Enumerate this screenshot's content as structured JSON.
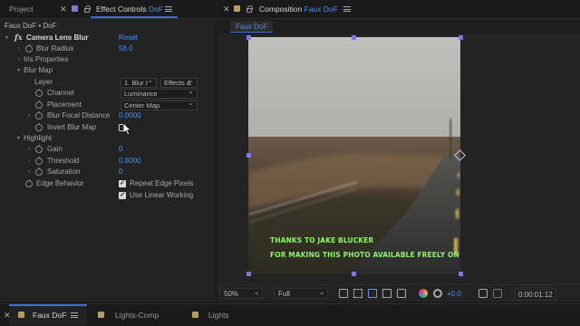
{
  "left_panel": {
    "tabs": [
      {
        "label": "Project"
      },
      {
        "label": "Effect Controls",
        "target": "DoF"
      }
    ],
    "breadcrumb": "Faux DoF • DoF",
    "effect": {
      "fx_label": "fx",
      "name": "Camera Lens Blur",
      "reset_label": "Reset"
    },
    "properties": {
      "blur_radius": {
        "label": "Blur Radius",
        "value": "56.0"
      },
      "iris_properties": {
        "label": "Iris Properties"
      },
      "blur_map": {
        "label": "Blur Map"
      },
      "layer": {
        "label": "Layer",
        "value": "1. Blur I",
        "source": "Effects &"
      },
      "channel": {
        "label": "Channel",
        "value": "Luminance"
      },
      "placement": {
        "label": "Placement",
        "value": "Center Map"
      },
      "blur_focal_distance": {
        "label": "Blur Focal Distance",
        "value": "0.0000"
      },
      "invert_blur_map": {
        "label": "Invert Blur Map",
        "checked": false
      },
      "highlight": {
        "label": "Highlight"
      },
      "gain": {
        "label": "Gain",
        "value": "0"
      },
      "threshold": {
        "label": "Threshold",
        "value": "0.8000"
      },
      "saturation": {
        "label": "Saturation",
        "value": "0"
      },
      "edge_behavior": {
        "label": "Edge Behavior",
        "repeat_edge_pixels": {
          "label": "Repeat Edge Pixels",
          "checked": true
        },
        "use_linear_working": {
          "label": "Use Linear Working",
          "checked": true
        }
      }
    }
  },
  "right_panel": {
    "tab": {
      "label": "Composition",
      "target": "Faux DoF"
    },
    "subtab": "Faux DoF",
    "credit_lines": [
      "THANKS TO JAKE BLUCKER",
      "FOR MAKING THIS PHOTO AVAILABLE FREELY ON UNSPLASH.COM"
    ],
    "viewer_bar": {
      "zoom": "50%",
      "resolution": "Full",
      "exposure": "+0.0",
      "timecode": "0:00:01:12"
    }
  },
  "bottom_tabs": [
    {
      "label": "Faux DoF",
      "color": "#b59a6a",
      "active": true
    },
    {
      "label": "Lights-Comp",
      "color": "#b59a6a",
      "active": false
    },
    {
      "label": "Lights",
      "color": "#b59a6a",
      "active": false
    }
  ],
  "colors": {
    "accent_blue": "#4e8ff0",
    "label_purple": "#7b7bd8",
    "comp_tan": "#b59a6a",
    "credit_green": "#8ef26b"
  }
}
